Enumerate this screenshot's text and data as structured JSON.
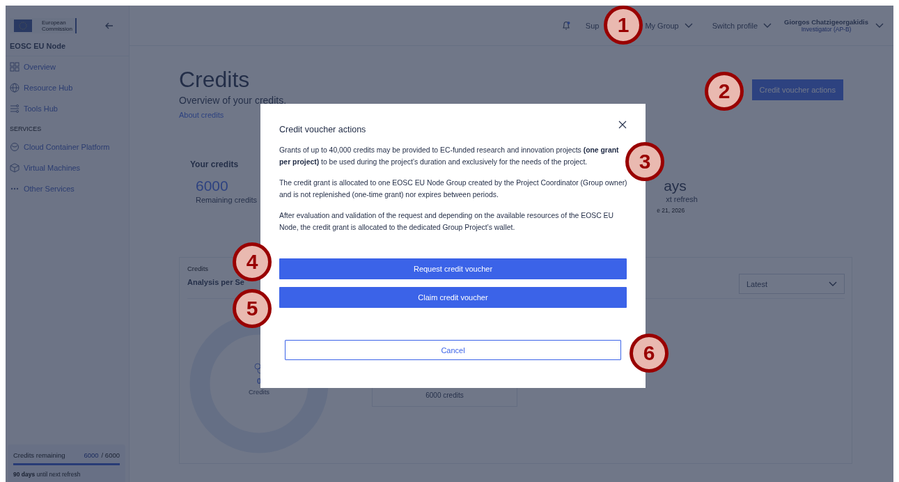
{
  "sidebar": {
    "brand": {
      "line_1": "European",
      "line_2": "Commission"
    },
    "node_title": "EOSC EU Node",
    "items": [
      {
        "label": "Overview"
      },
      {
        "label": "Resource Hub"
      },
      {
        "label": "Tools Hub"
      }
    ],
    "section": "SERVICES",
    "service_items": [
      {
        "label": "Cloud Container Platform"
      },
      {
        "label": "Virtual Machines"
      },
      {
        "label": "Other Services"
      }
    ],
    "credits_box": {
      "label": "Credits remaining",
      "remaining": "6000",
      "total": "/ 6000",
      "level": 1,
      "note": "**90 days** until next refresh"
    }
  },
  "topbar": {
    "has_notification": true,
    "links": [
      {
        "label": "Sup",
        "dropdown": false
      },
      {
        "label": "My Group",
        "dropdown": true
      },
      {
        "label": "Switch profile",
        "dropdown": true
      }
    ],
    "user": {
      "name": "Giorgos Chatzigeorgakidis",
      "role": "Investigator (AP-B)"
    }
  },
  "page": {
    "title": "Credits",
    "subtitle": "Overview of your credits.",
    "link": "About credits",
    "action_button": "Credit voucher actions"
  },
  "stats": {
    "heading": "Your credits",
    "value": "6000",
    "value_label": "Remaining credits",
    "other": {
      "value": "ays",
      "label": "xt refresh",
      "date": "e 21, 2026"
    }
  },
  "analysis": {
    "caption": "Credits",
    "title": "Analysis per Se",
    "select": "Latest",
    "donut": {
      "value": "0",
      "label": "Credits"
    },
    "legend": "6000 credits"
  },
  "modal": {
    "title": "Credit voucher actions",
    "paragraphs": [
      "Grants of up to 40,000 credits may be provided to EC-funded research and innovation projects **(one grant per project)** to be used during the project’s duration and exclusively for the needs of the project.",
      "The credit grant is allocated to one EOSC EU Node Group created by the Project Coordinator (Group owner) and is not replenished (one-time grant) nor expires between periods.",
      "After evaluation and validation of the request and depending on the available resources of the EOSC EU Node, the credit grant is allocated to the dedicated Group Project’s wallet."
    ],
    "buttons": [
      {
        "label": "Request credit voucher",
        "kind": "primary"
      },
      {
        "label": "Claim credit voucher",
        "kind": "primary"
      },
      {
        "label": "Cancel",
        "kind": "outline"
      }
    ]
  },
  "callouts": [
    {
      "label": "1"
    },
    {
      "label": "2"
    },
    {
      "label": "3"
    },
    {
      "label": "4"
    },
    {
      "label": "5"
    },
    {
      "label": "6"
    }
  ]
}
